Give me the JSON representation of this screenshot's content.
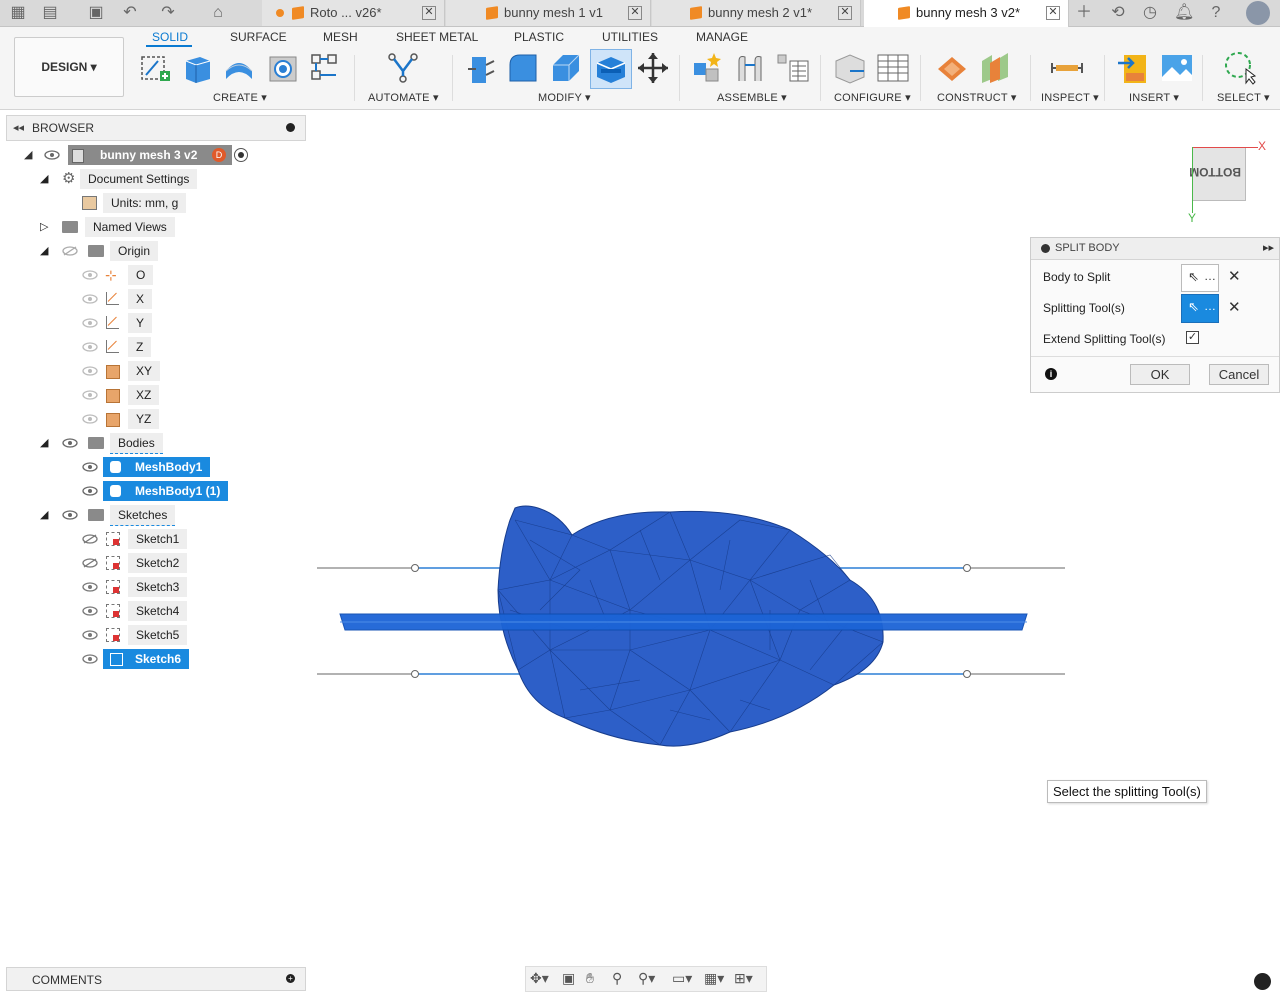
{
  "tabs": [
    {
      "label": "Roto ... v26*"
    },
    {
      "label": "bunny mesh 1 v1"
    },
    {
      "label": "bunny mesh 2 v1*"
    },
    {
      "label": "bunny mesh 3 v2*"
    }
  ],
  "workspace": {
    "label": "DESIGN"
  },
  "ribbon_tabs": [
    "SOLID",
    "SURFACE",
    "MESH",
    "SHEET METAL",
    "PLASTIC",
    "UTILITIES",
    "MANAGE"
  ],
  "groups": [
    "CREATE",
    "AUTOMATE",
    "MODIFY",
    "ASSEMBLE",
    "CONFIGURE",
    "CONSTRUCT",
    "INSPECT",
    "INSERT",
    "SELECT"
  ],
  "browser": {
    "title": "BROWSER",
    "root": "bunny mesh 3 v2",
    "doc_settings": "Document Settings",
    "units": "Units: mm, g",
    "named_views": "Named Views",
    "origin": "Origin",
    "origin_items": [
      "O",
      "X",
      "Y",
      "Z",
      "XY",
      "XZ",
      "YZ"
    ],
    "bodies": "Bodies",
    "body_items": [
      "MeshBody1",
      "MeshBody1 (1)"
    ],
    "sketches": "Sketches",
    "sketch_items": [
      "Sketch1",
      "Sketch2",
      "Sketch3",
      "Sketch4",
      "Sketch5",
      "Sketch6"
    ]
  },
  "viewcube": {
    "face": "BOTTOM",
    "axis_x": "X",
    "axis_y": "Y"
  },
  "split_body": {
    "title": "SPLIT BODY",
    "body_to_split": "Body to Split",
    "splitting_tools": "Splitting Tool(s)",
    "extend": "Extend Splitting Tool(s)",
    "ok": "OK",
    "cancel": "Cancel"
  },
  "tooltip": "Select the splitting Tool(s)",
  "comments": "COMMENTS",
  "colors": {
    "accent": "#0a7ad1",
    "selection": "#1a8adf",
    "mesh": "#2d5fc8"
  }
}
